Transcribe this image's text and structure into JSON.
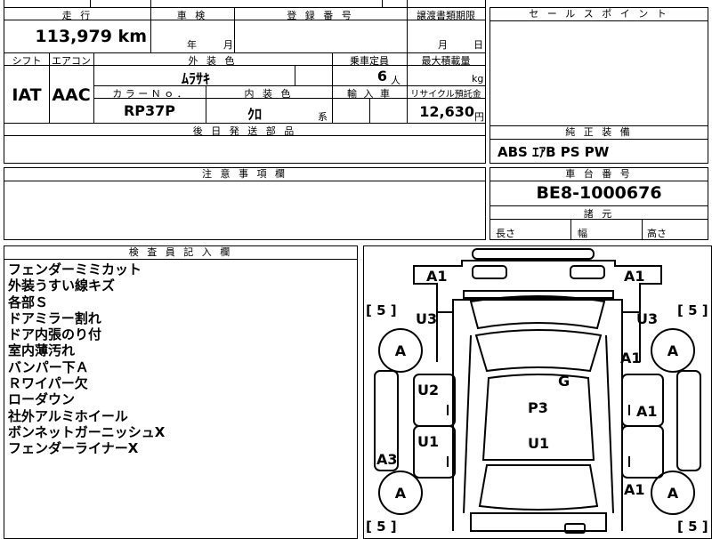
{
  "top": {
    "mileage_header": "走 行",
    "mileage_value": "113,979 km",
    "inspection_header": "車 検",
    "inspection_year": "年",
    "inspection_month": "月",
    "registration_header": "登 録 番 号",
    "transfer_header": "譲渡書類期限",
    "transfer_month": "月",
    "transfer_day": "日",
    "shift_header": "シフト",
    "shift_value": "IAT",
    "ac_header": "エアコン",
    "ac_value": "AAC",
    "exterior_header": "外 装 色",
    "exterior_value": "ﾑﾗｻｷ",
    "capacity_header": "乗車定員",
    "capacity_value": "6",
    "capacity_unit": "人",
    "load_header": "最大積載量",
    "load_unit": "kg",
    "color_no_header": "カ ラ ー Ｎ ｏ ．",
    "color_no_value": "RP37P",
    "interior_header": "内 装 色",
    "interior_value": "ｸﾛ",
    "interior_unit": "系",
    "import_header": "輸 入 車",
    "recycle_header": "リサイクル預託金",
    "recycle_value": "12,630",
    "recycle_unit": "円",
    "later_parts_header": "後 日 発 送 部 品"
  },
  "sales_point": {
    "header": "セ ー ル ス ポ イ ン ト"
  },
  "equipment": {
    "header": "純 正 装 備",
    "value": "ABS ｴｱB PS PW"
  },
  "notes": {
    "header": "注 意 事 項 欄"
  },
  "chassis": {
    "header": "車 台 番 号",
    "value": "BE8-1000676",
    "dims_header": "諸 元",
    "length": "長さ",
    "width": "幅",
    "height": "高さ"
  },
  "inspector": {
    "header": "検 査 員 記 入 欄",
    "items": [
      "フェンダーミミカット",
      "外装うすい線キズ",
      "各部Ｓ",
      "ドアミラー割れ",
      "ドア内張のり付",
      "室内薄汚れ",
      "バンパー下Ａ",
      "Ｒワイパー欠",
      "ローダウン",
      "社外アルミホイール",
      "ボンネットガーニッシュX",
      "フェンダーライナーX"
    ]
  },
  "diagram": {
    "a1_front_left": "A1",
    "a1_front_right": "A1",
    "bracket_left_top": "[ 5 ]",
    "bracket_right_top": "[ 5 ]",
    "bracket_left_bottom": "[ 5 ]",
    "bracket_right_bottom": "[ 5 ]",
    "u3_left": "U3",
    "u3_right": "U3",
    "tire_front_left": "A",
    "tire_front_right": "A",
    "tire_rear_left": "A",
    "tire_rear_right": "A",
    "a1_right_front": "A1",
    "g_label": "G",
    "u2_left": "U2",
    "p3_label": "P3",
    "a1_right_mid": "A1",
    "u1_left": "U1",
    "u1_center": "U1",
    "a3_left": "A3",
    "a1_right_rear": "A1"
  }
}
